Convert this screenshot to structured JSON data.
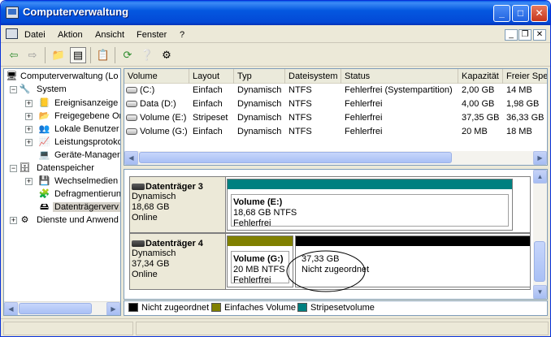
{
  "window": {
    "title": "Computerverwaltung",
    "buttons": {
      "minimize": "_",
      "maximize": "□",
      "close": "✕"
    }
  },
  "menu": {
    "items": [
      "Datei",
      "Aktion",
      "Ansicht",
      "Fenster",
      "?"
    ],
    "child_buttons": {
      "minimize": "_",
      "restore": "❐",
      "close": "✕"
    }
  },
  "toolbar": {
    "icons": [
      "back-arrow-icon",
      "forward-arrow-icon",
      "up-folder-icon",
      "show-hide-tree-icon",
      "properties-icon",
      "refresh-icon",
      "help-icon",
      "disk-settings-icon"
    ],
    "glyphs": {
      "back": "⇦",
      "forward": "⇨",
      "up": "📁",
      "tree": "▤",
      "properties": "📋",
      "refresh": "⟳",
      "help": "❔",
      "settings": "⚙"
    }
  },
  "tree": {
    "root": "Computerverwaltung (Lo",
    "items": [
      {
        "label": "System",
        "level": 1,
        "toggle": "−"
      },
      {
        "label": "Ereignisanzeige",
        "level": 2,
        "toggle": "+"
      },
      {
        "label": "Freigegebene Or",
        "level": 2,
        "toggle": "+"
      },
      {
        "label": "Lokale Benutzer",
        "level": 2,
        "toggle": "+"
      },
      {
        "label": "Leistungsprotoko",
        "level": 2,
        "toggle": "+"
      },
      {
        "label": "Geräte-Manager",
        "level": 2,
        "toggle": ""
      },
      {
        "label": "Datenspeicher",
        "level": 1,
        "toggle": "−"
      },
      {
        "label": "Wechselmedien",
        "level": 2,
        "toggle": "+"
      },
      {
        "label": "Defragmentierun",
        "level": 2,
        "toggle": ""
      },
      {
        "label": "Datenträgerverv",
        "level": 2,
        "toggle": "",
        "selected": true
      },
      {
        "label": "Dienste und Anwend",
        "level": 1,
        "toggle": "+"
      }
    ]
  },
  "volumes": {
    "columns": [
      "Volume",
      "Layout",
      "Typ",
      "Dateisystem",
      "Status",
      "Kapazität",
      "Freier Spe"
    ],
    "rows": [
      [
        "(C:)",
        "Einfach",
        "Dynamisch",
        "NTFS",
        "Fehlerfrei (Systempartition)",
        "2,00 GB",
        "14 MB"
      ],
      [
        "Data (D:)",
        "Einfach",
        "Dynamisch",
        "NTFS",
        "Fehlerfrei",
        "4,00 GB",
        "1,98 GB"
      ],
      [
        "Volume (E:)",
        "Stripeset",
        "Dynamisch",
        "NTFS",
        "Fehlerfrei",
        "37,35 GB",
        "36,33 GB"
      ],
      [
        "Volume (G:)",
        "Einfach",
        "Dynamisch",
        "NTFS",
        "Fehlerfrei",
        "20 MB",
        "18 MB"
      ]
    ]
  },
  "disks": [
    {
      "name": "Datenträger 3",
      "type": "Dynamisch",
      "size": "18,68 GB",
      "state": "Online",
      "partitions": [
        {
          "title": "Volume  (E:)",
          "line1": "18,68 GB NTFS",
          "line2": "Fehlerfrei",
          "color": "#008080"
        }
      ]
    },
    {
      "name": "Datenträger 4",
      "type": "Dynamisch",
      "size": "37,34 GB",
      "state": "Online",
      "partitions": [
        {
          "title": "Volume  (G:)",
          "line1": "20 MB NTFS",
          "line2": "Fehlerfrei",
          "color": "#808000"
        },
        {
          "title": "",
          "line1": "37,33 GB",
          "line2": "Nicht zugeordnet",
          "color": "#000000"
        }
      ]
    }
  ],
  "legend": [
    {
      "label": "Nicht zugeordnet",
      "color": "#000000"
    },
    {
      "label": "Einfaches Volume",
      "color": "#808000"
    },
    {
      "label": "Stripesetvolume",
      "color": "#008080"
    }
  ],
  "scroll": {
    "left": "◀",
    "right": "▶",
    "up": "▲",
    "down": "▼"
  }
}
